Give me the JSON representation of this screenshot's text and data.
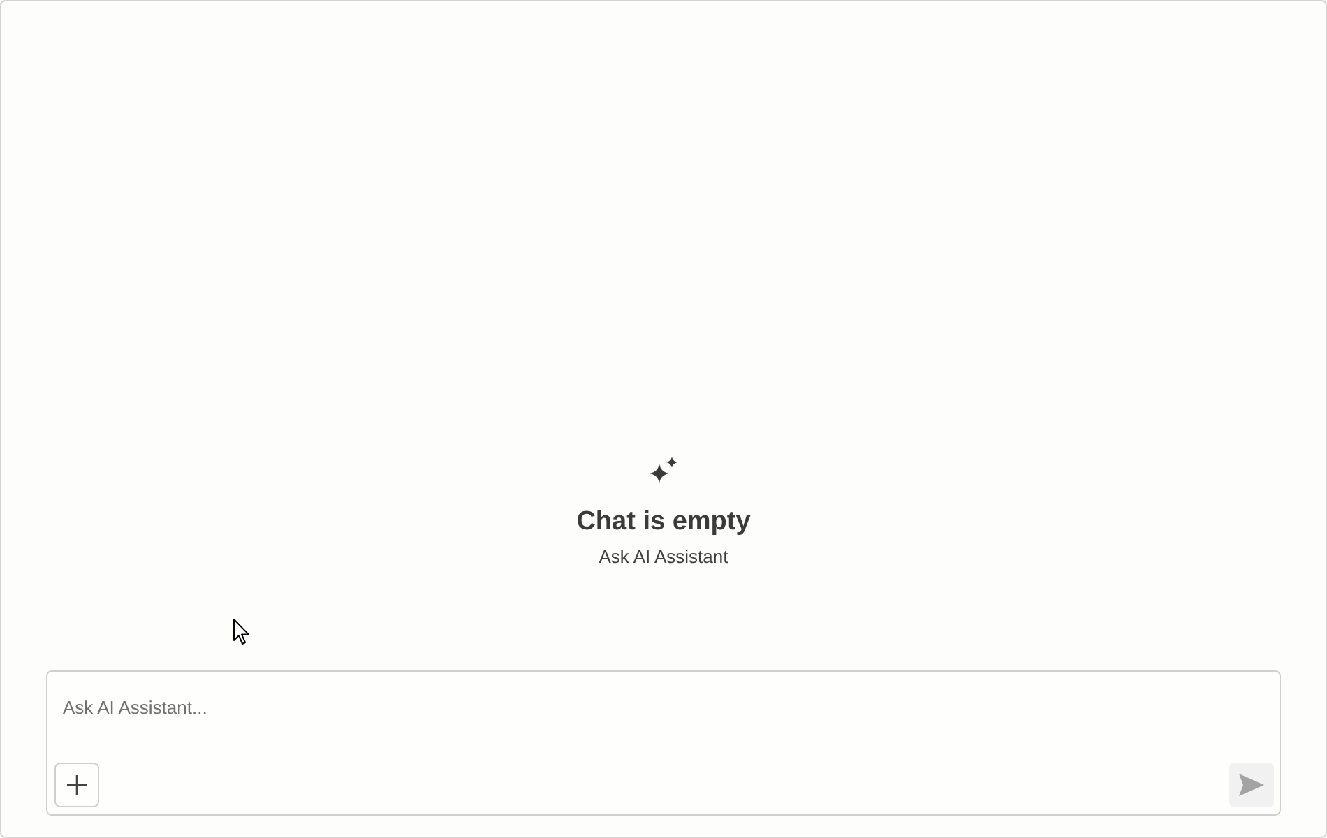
{
  "empty_state": {
    "title": "Chat is empty",
    "subtitle": "Ask AI Assistant"
  },
  "composer": {
    "placeholder": "Ask AI Assistant...",
    "send_button": {
      "disabled": true
    }
  }
}
